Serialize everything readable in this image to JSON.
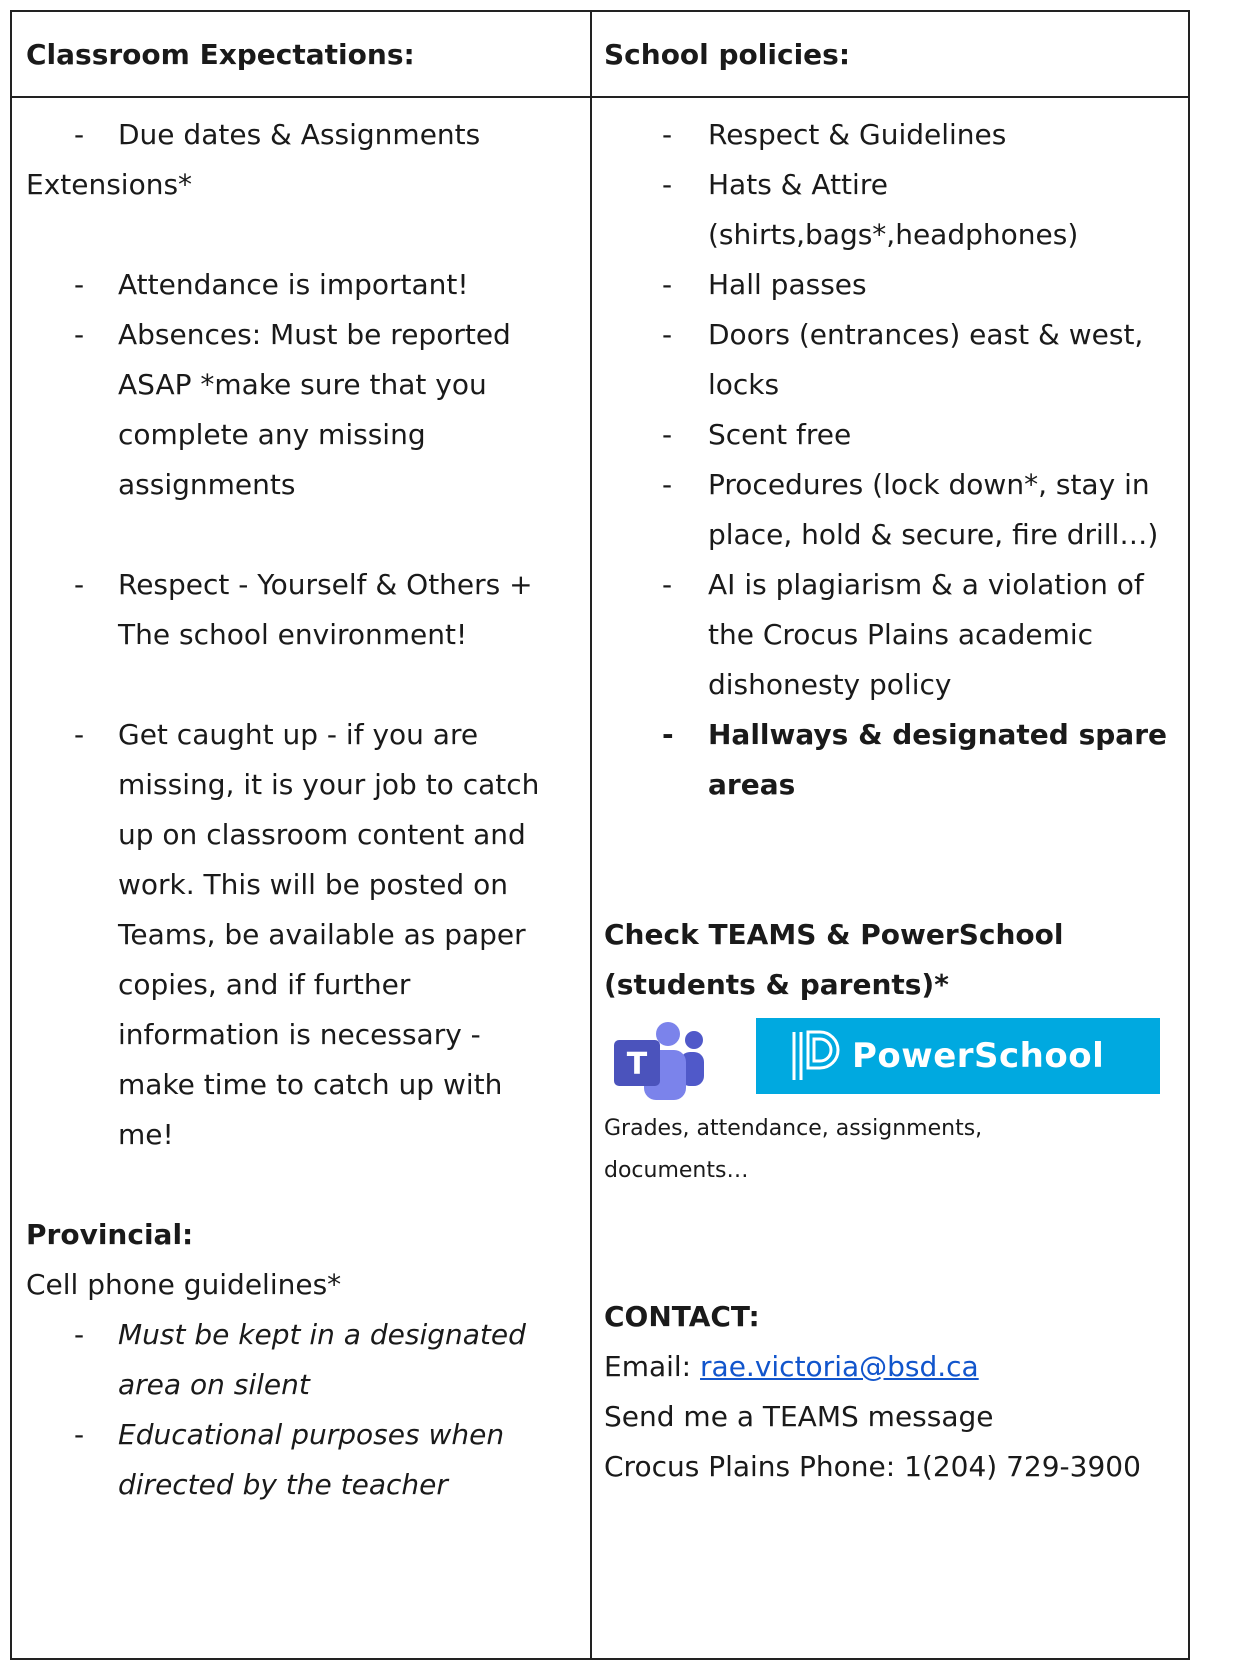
{
  "left": {
    "header": "Classroom Expectations:",
    "due_dates_line1": "Due dates & Assignments",
    "due_dates_line2": "Extensions*",
    "attendance": "Attendance is important!",
    "absences": [
      "Absences: Must be reported",
      "ASAP *make sure that you",
      "complete any missing",
      "assignments"
    ],
    "respect": [
      "Respect - Yourself & Others +",
      "The school environment!"
    ],
    "caught_up": [
      "Get caught up - if you are",
      "missing, it is your job to catch",
      "up on classroom content and",
      "work. This will be posted on",
      "Teams, be available as paper",
      "copies, and if further",
      "information is necessary -",
      "make time to catch up with",
      "me!"
    ],
    "provincial_heading": "Provincial:",
    "cell_phone": "Cell phone guidelines*",
    "cell_items": [
      [
        "Must be kept in a designated",
        "area on silent"
      ],
      [
        "Educational purposes when",
        "directed by the teacher"
      ]
    ]
  },
  "right": {
    "header": "School policies:",
    "items": [
      [
        "Respect & Guidelines"
      ],
      [
        "Hats & Attire",
        "(shirts,bags*,headphones)"
      ],
      [
        "Hall passes"
      ],
      [
        "Doors (entrances) east & west,",
        "locks"
      ],
      [
        "Scent free"
      ],
      [
        "Procedures (lock down*, stay in",
        "place, hold & secure, fire drill…)"
      ],
      [
        "AI is plagiarism & a violation of",
        "the Crocus Plains academic",
        "dishonesty policy"
      ]
    ],
    "bold_item": [
      "Hallways & designated spare",
      "areas"
    ],
    "check_line1": "Check TEAMS & PowerSchool",
    "check_line2": "(students & parents)*",
    "teams_letter": "T",
    "powerschool_label": "PowerSchool",
    "grades_line1": "Grades, attendance, assignments,",
    "grades_line2": "documents…",
    "contact_heading": "CONTACT:",
    "email_label": "Email: ",
    "email": "rae.victoria@bsd.ca",
    "teams_msg": "Send me a TEAMS message",
    "phone": "Crocus Plains Phone: 1(204) 729-3900"
  },
  "dash": "-",
  "colors": {
    "border": "#222222",
    "link": "#1155cc",
    "powerschool_bg": "#00a9e0",
    "teams_purple": "#5059c9"
  }
}
